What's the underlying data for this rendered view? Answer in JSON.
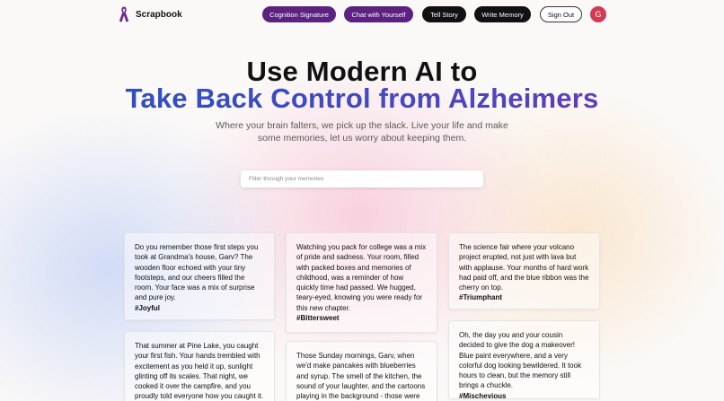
{
  "app": {
    "name": "Scrapbook",
    "logo_icon": "awareness-ribbon-icon",
    "accent_color": "#5b2280"
  },
  "nav": {
    "cognition": "Cognition Signature",
    "chat": "Chat with Yourself",
    "tell_story": "Tell Story",
    "write_memory": "Write Memory",
    "sign_out": "Sign Out",
    "avatar_initial": "G"
  },
  "hero": {
    "line1": "Use Modern AI to",
    "line2": "Take Back Control from Alzheimers",
    "subtitle": "Where your brain falters, we pick up the slack. Live your life and make some memories, let us worry about keeping them."
  },
  "search": {
    "placeholder": "Filter through your memories",
    "value": ""
  },
  "memories": [
    {
      "text": "Do you remember those first steps you took at Grandma's house, Garv? The wooden floor echoed with your tiny footsteps, and our cheers filled the room. Your face was a mix of surprise and pure joy.",
      "tag": "#Joyful"
    },
    {
      "text": "Watching you pack for college was a mix of pride and sadness. Your room, filled with packed boxes and memories of childhood, was a reminder of how quickly time had passed. We hugged, teary-eyed, knowing you were ready for this new chapter.",
      "tag": "#Bittersweet"
    },
    {
      "text": "The science fair where your volcano project erupted, not just with lava but with applause. Your months of hard work had paid off, and the blue ribbon was the cherry on top.",
      "tag": "#Triumphant"
    },
    {
      "text": "That summer at Pine Lake, you caught your first fish. Your hands trembled with excitement as you held it up, sunlight glinting off its scales. That night, we cooked it over the campfire, and you proudly told everyone how you caught it.",
      "tag": ""
    },
    {
      "text": "Those Sunday mornings, Garv, when we'd make pancakes with blueberries and syrup. The smell of the kitchen, the sound of your laughter, and the cartoons playing in the background - those were golden",
      "tag": ""
    },
    {
      "text": "Oh, the day you and your cousin decided to give the dog a makeover! Blue paint everywhere, and a very colorful dog looking bewildered. It took hours to clean, but the memory still brings a chuckle.",
      "tag": "#Mischevious"
    }
  ]
}
